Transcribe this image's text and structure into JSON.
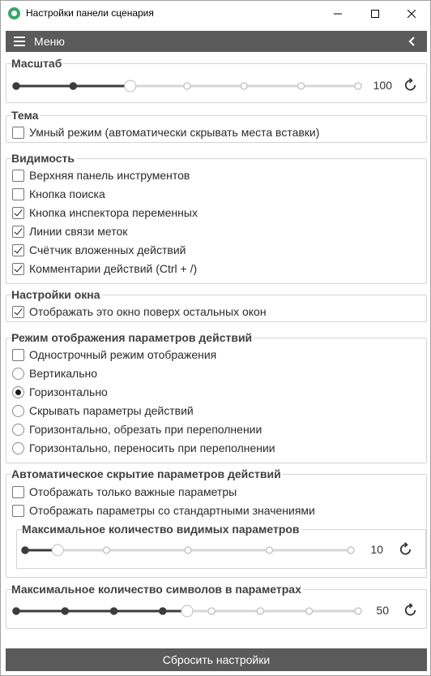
{
  "window": {
    "title": "Настройки панели сценария"
  },
  "menu": {
    "label": "Меню"
  },
  "scale": {
    "legend": "Масштаб",
    "stops": 7,
    "active_stop": 2,
    "value": "100"
  },
  "theme": {
    "legend": "Тема",
    "smart_mode": {
      "label": "Умный режим (автоматически скрывать места вставки)",
      "checked": false
    }
  },
  "visibility": {
    "legend": "Видимость",
    "items": [
      {
        "label": "Верхняя панель инструментов",
        "checked": false
      },
      {
        "label": "Кнопка поиска",
        "checked": false
      },
      {
        "label": "Кнопка инспектора переменных",
        "checked": true
      },
      {
        "label": "Линии связи меток",
        "checked": true
      },
      {
        "label": "Счётчик вложенных действий",
        "checked": true
      },
      {
        "label": "Комментарии действий (Ctrl + /)",
        "checked": true
      }
    ]
  },
  "window_settings": {
    "legend": "Настройки окна",
    "on_top": {
      "label": "Отображать это окно поверх остальных окон",
      "checked": true
    }
  },
  "param_display": {
    "legend": "Режим отображения параметров действий",
    "single_line": {
      "label": "Однострочный режим отображения",
      "checked": false
    },
    "options": [
      {
        "label": "Вертикально",
        "checked": false
      },
      {
        "label": "Горизонтально",
        "checked": true
      },
      {
        "label": "Скрывать параметры действий",
        "checked": false
      },
      {
        "label": "Горизонтально, обрезать при переполнении",
        "checked": false
      },
      {
        "label": "Горизонтально, переносить при переполнении",
        "checked": false
      }
    ]
  },
  "auto_hide": {
    "legend": "Автоматическое скрытие параметров действий",
    "items": [
      {
        "label": "Отображать только важные параметры",
        "checked": false
      },
      {
        "label": "Отображать параметры со стандартными значениями",
        "checked": false
      }
    ],
    "max_visible": {
      "legend": "Максимальное количество видимых параметров",
      "stops": 5,
      "active_stop": 0.4,
      "value": "10"
    }
  },
  "max_chars": {
    "legend": "Максимальное количество символов в параметрах",
    "stops": 8,
    "active_stop": 3.5,
    "value": "50"
  },
  "footer": {
    "reset_label": "Сбросить настройки"
  },
  "colors": {
    "accent": "#5a5a5a",
    "slider_active": "#3c3c3c",
    "slider_inactive": "#d6d6d6"
  }
}
